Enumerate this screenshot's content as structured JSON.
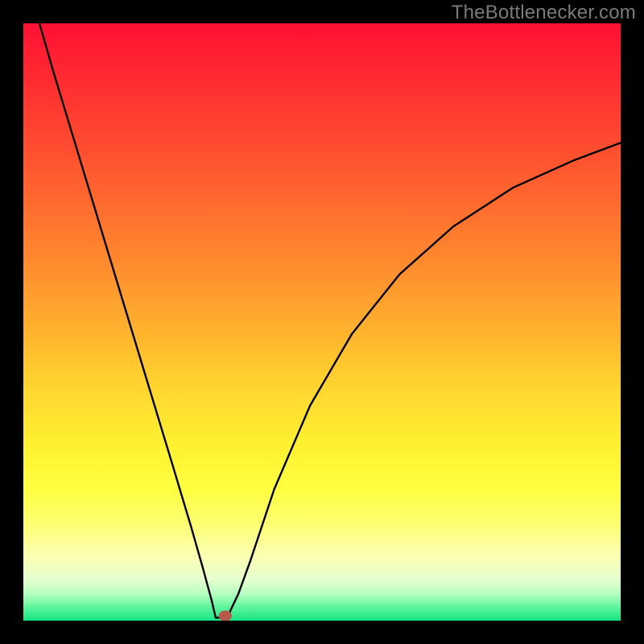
{
  "watermark": {
    "text": "TheBottlenecker.com"
  },
  "chart_data": {
    "type": "line",
    "title": "",
    "xlabel": "",
    "ylabel": "",
    "xlim": [
      0,
      100
    ],
    "ylim": [
      0,
      100
    ],
    "background_gradient": {
      "type": "vertical",
      "stops": [
        {
          "pos": 0.0,
          "color": "#ff1033"
        },
        {
          "pos": 0.1,
          "color": "#ff2d31"
        },
        {
          "pos": 0.2,
          "color": "#ff4a30"
        },
        {
          "pos": 0.3,
          "color": "#ff6a2f"
        },
        {
          "pos": 0.4,
          "color": "#ff8a2e"
        },
        {
          "pos": 0.5,
          "color": "#ffad2e"
        },
        {
          "pos": 0.6,
          "color": "#ffd22f"
        },
        {
          "pos": 0.7,
          "color": "#fff031"
        },
        {
          "pos": 0.78,
          "color": "#ffff40"
        },
        {
          "pos": 0.84,
          "color": "#fdff74"
        },
        {
          "pos": 0.89,
          "color": "#fcffb0"
        },
        {
          "pos": 0.93,
          "color": "#e6ffcf"
        },
        {
          "pos": 0.955,
          "color": "#b7ffc1"
        },
        {
          "pos": 0.975,
          "color": "#68f6a0"
        },
        {
          "pos": 1.0,
          "color": "#14e481"
        }
      ]
    },
    "curve": {
      "description": "Asymmetric V-shaped bottleneck curve",
      "left": {
        "x": [
          2.7,
          5,
          10,
          15,
          20,
          25,
          28,
          30,
          31.5,
          32.2
        ],
        "y": [
          100,
          92,
          75.5,
          59,
          42.5,
          26,
          16,
          9,
          3.5,
          0.5
        ]
      },
      "trough": {
        "x": [
          32.2,
          34.1
        ],
        "y": [
          0.5,
          0.5
        ]
      },
      "right": {
        "x": [
          34.1,
          36,
          38,
          42,
          48,
          55,
          63,
          72,
          82,
          92,
          100
        ],
        "y": [
          0.5,
          4.5,
          10,
          22,
          36,
          48,
          58,
          66,
          72.5,
          77,
          80
        ]
      }
    },
    "marker": {
      "x": 33.8,
      "y": 0.8,
      "rx": 1.1,
      "ry": 0.9,
      "color": "#b55a4a"
    }
  }
}
